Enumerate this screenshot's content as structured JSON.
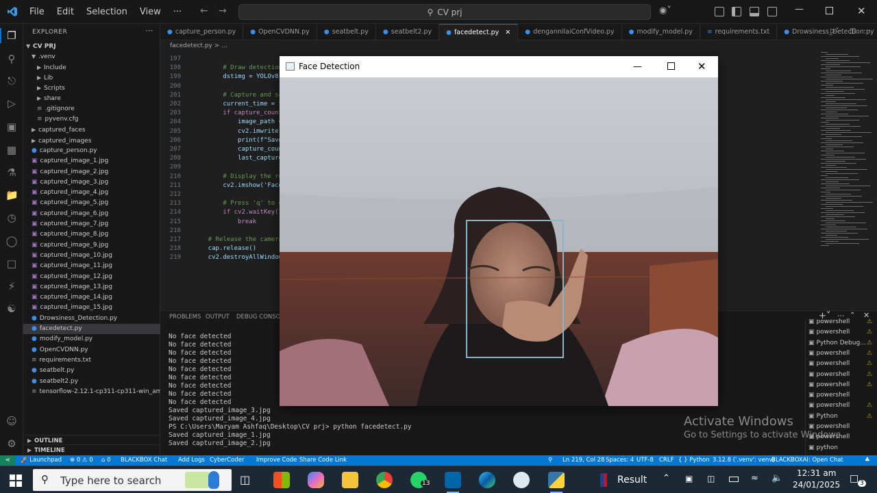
{
  "titlebar": {
    "menu": [
      "File",
      "Edit",
      "Selection",
      "View",
      "···"
    ],
    "search": "CV prj"
  },
  "explorer": {
    "title": "EXPLORER",
    "root": "CV PRJ",
    "items": [
      {
        "label": ".venv",
        "kind": "folder-open",
        "indent": 1
      },
      {
        "label": "Include",
        "kind": "folder",
        "indent": 2
      },
      {
        "label": "Lib",
        "kind": "folder",
        "indent": 2
      },
      {
        "label": "Scripts",
        "kind": "folder",
        "indent": 2
      },
      {
        "label": "share",
        "kind": "folder",
        "indent": 2
      },
      {
        "label": ".gitignore",
        "kind": "file",
        "indent": 2
      },
      {
        "label": "pyvenv.cfg",
        "kind": "file",
        "indent": 2
      },
      {
        "label": "captured_faces",
        "kind": "folder",
        "indent": 1
      },
      {
        "label": "captured_images",
        "kind": "folder",
        "indent": 1
      },
      {
        "label": "capture_person.py",
        "kind": "py",
        "indent": 1
      },
      {
        "label": "captured_image_1.jpg",
        "kind": "img",
        "indent": 1
      },
      {
        "label": "captured_image_2.jpg",
        "kind": "img",
        "indent": 1
      },
      {
        "label": "captured_image_3.jpg",
        "kind": "img",
        "indent": 1
      },
      {
        "label": "captured_image_4.jpg",
        "kind": "img",
        "indent": 1
      },
      {
        "label": "captured_image_5.jpg",
        "kind": "img",
        "indent": 1
      },
      {
        "label": "captured_image_6.jpg",
        "kind": "img",
        "indent": 1
      },
      {
        "label": "captured_image_7.jpg",
        "kind": "img",
        "indent": 1
      },
      {
        "label": "captured_image_8.jpg",
        "kind": "img",
        "indent": 1
      },
      {
        "label": "captured_image_9.jpg",
        "kind": "img",
        "indent": 1
      },
      {
        "label": "captured_image_10.jpg",
        "kind": "img",
        "indent": 1
      },
      {
        "label": "captured_image_11.jpg",
        "kind": "img",
        "indent": 1
      },
      {
        "label": "captured_image_12.jpg",
        "kind": "img",
        "indent": 1
      },
      {
        "label": "captured_image_13.jpg",
        "kind": "img",
        "indent": 1
      },
      {
        "label": "captured_image_14.jpg",
        "kind": "img",
        "indent": 1
      },
      {
        "label": "captured_image_15.jpg",
        "kind": "img",
        "indent": 1
      },
      {
        "label": "Drowsiness_Detection.py",
        "kind": "py",
        "indent": 1
      },
      {
        "label": "facedetect.py",
        "kind": "py",
        "indent": 1,
        "selected": true
      },
      {
        "label": "modify_model.py",
        "kind": "py",
        "indent": 1
      },
      {
        "label": "OpenCVDNN.py",
        "kind": "py",
        "indent": 1
      },
      {
        "label": "requirements.txt",
        "kind": "txt",
        "indent": 1
      },
      {
        "label": "seatbelt.py",
        "kind": "py",
        "indent": 1
      },
      {
        "label": "seatbelt2.py",
        "kind": "py",
        "indent": 1
      },
      {
        "label": "tensorflow-2.12.1-cp311-cp311-win_amd6...",
        "kind": "file",
        "indent": 1
      }
    ],
    "outline": "OUTLINE",
    "timeline": "TIMELINE"
  },
  "tabs": [
    {
      "label": "capture_person.py",
      "active": false
    },
    {
      "label": "OpenCVDNN.py",
      "active": false
    },
    {
      "label": "seatbelt.py",
      "active": false
    },
    {
      "label": "seatbelt2.py",
      "active": false
    },
    {
      "label": "facedetect.py",
      "active": true
    },
    {
      "label": "dengannilaiConfVideo.py",
      "active": false
    },
    {
      "label": "modify_model.py",
      "active": false
    },
    {
      "label": "requirements.txt",
      "active": false
    },
    {
      "label": "Drowsiness_Detection.py",
      "active": false
    }
  ],
  "breadcrumb": "facedetect.py > ...",
  "code": [
    {
      "n": "197",
      "t": ""
    },
    {
      "n": "198",
      "t": "        # Draw detection"
    },
    {
      "n": "199",
      "t": "        dstimg = YOLOv8_"
    },
    {
      "n": "200",
      "t": ""
    },
    {
      "n": "201",
      "t": "        # Capture and sa"
    },
    {
      "n": "202",
      "t": "        current_time = t"
    },
    {
      "n": "203",
      "t": "        if capture_count"
    },
    {
      "n": "204",
      "t": "            image_path ="
    },
    {
      "n": "205",
      "t": "            cv2.imwrite("
    },
    {
      "n": "206",
      "t": "            print(f\"Save"
    },
    {
      "n": "207",
      "t": "            capture_coun"
    },
    {
      "n": "208",
      "t": "            last_capture"
    },
    {
      "n": "209",
      "t": ""
    },
    {
      "n": "210",
      "t": "        # Display the re"
    },
    {
      "n": "211",
      "t": "        cv2.imshow('Face"
    },
    {
      "n": "212",
      "t": ""
    },
    {
      "n": "213",
      "t": "        # Press 'q' to e"
    },
    {
      "n": "214",
      "t": "        if cv2.waitKey(1"
    },
    {
      "n": "215",
      "t": "            break"
    },
    {
      "n": "216",
      "t": ""
    },
    {
      "n": "217",
      "t": "    # Release the camera"
    },
    {
      "n": "218",
      "t": "    cap.release()"
    },
    {
      "n": "219",
      "t": "    cv2.destroyAllWindow"
    }
  ],
  "panel": {
    "tabs": [
      "PROBLEMS",
      "OUTPUT",
      "DEBUG CONSOLE"
    ],
    "terminal": [
      "No face detected",
      "No face detected",
      "No face detected",
      "No face detected",
      "No face detected",
      "No face detected",
      "No face detected",
      "No face detected",
      "No face detected",
      "Saved captured_image_3.jpg",
      "Saved captured_image_4.jpg",
      "PS C:\\Users\\Maryam Ashfaq\\Desktop\\CV prj> python facedetect.py",
      "Saved captured_image_1.jpg",
      "Saved captured_image_2.jpg"
    ],
    "terminal_list": [
      {
        "label": "powershell",
        "warn": true
      },
      {
        "label": "powershell",
        "warn": true
      },
      {
        "label": "Python Debug...",
        "warn": true
      },
      {
        "label": "powershell",
        "warn": true
      },
      {
        "label": "powershell",
        "warn": true
      },
      {
        "label": "powershell",
        "warn": true
      },
      {
        "label": "powershell",
        "warn": true
      },
      {
        "label": "powershell",
        "warn": false
      },
      {
        "label": "powershell",
        "warn": true
      },
      {
        "label": "Python",
        "warn": true
      },
      {
        "label": "powershell",
        "warn": false
      },
      {
        "label": "powershell",
        "warn": false
      },
      {
        "label": "python",
        "warn": false
      }
    ]
  },
  "watermark": {
    "title": "Activate Windows",
    "sub": "Go to Settings to activate Windows."
  },
  "statusbar": {
    "left": [
      "Launchpad",
      "⊗ 0 ⚠ 0",
      "⌂ 0",
      "BLACKBOX Chat",
      "Add Logs",
      "CyberCoder",
      "Improve Code",
      "Share Code Link"
    ],
    "right": [
      "Ln 219, Col 28",
      "Spaces: 4",
      "UTF-8",
      "CRLF",
      "{ } Python",
      "3.12.8 ('.venv': venv)",
      "BLACKBOXAI: Open Chat"
    ]
  },
  "facewin": {
    "title": "Face Detection"
  },
  "taskbar": {
    "search_placeholder": "Type here to search",
    "whatsapp_badge": "13",
    "result_label": "Result",
    "time": "12:31 am",
    "date": "24/01/2025",
    "notif_count": "3"
  },
  "colors": {
    "accent": "#0078d4",
    "statusbar": "#0078d4",
    "face_box": "#8ab4c8"
  }
}
